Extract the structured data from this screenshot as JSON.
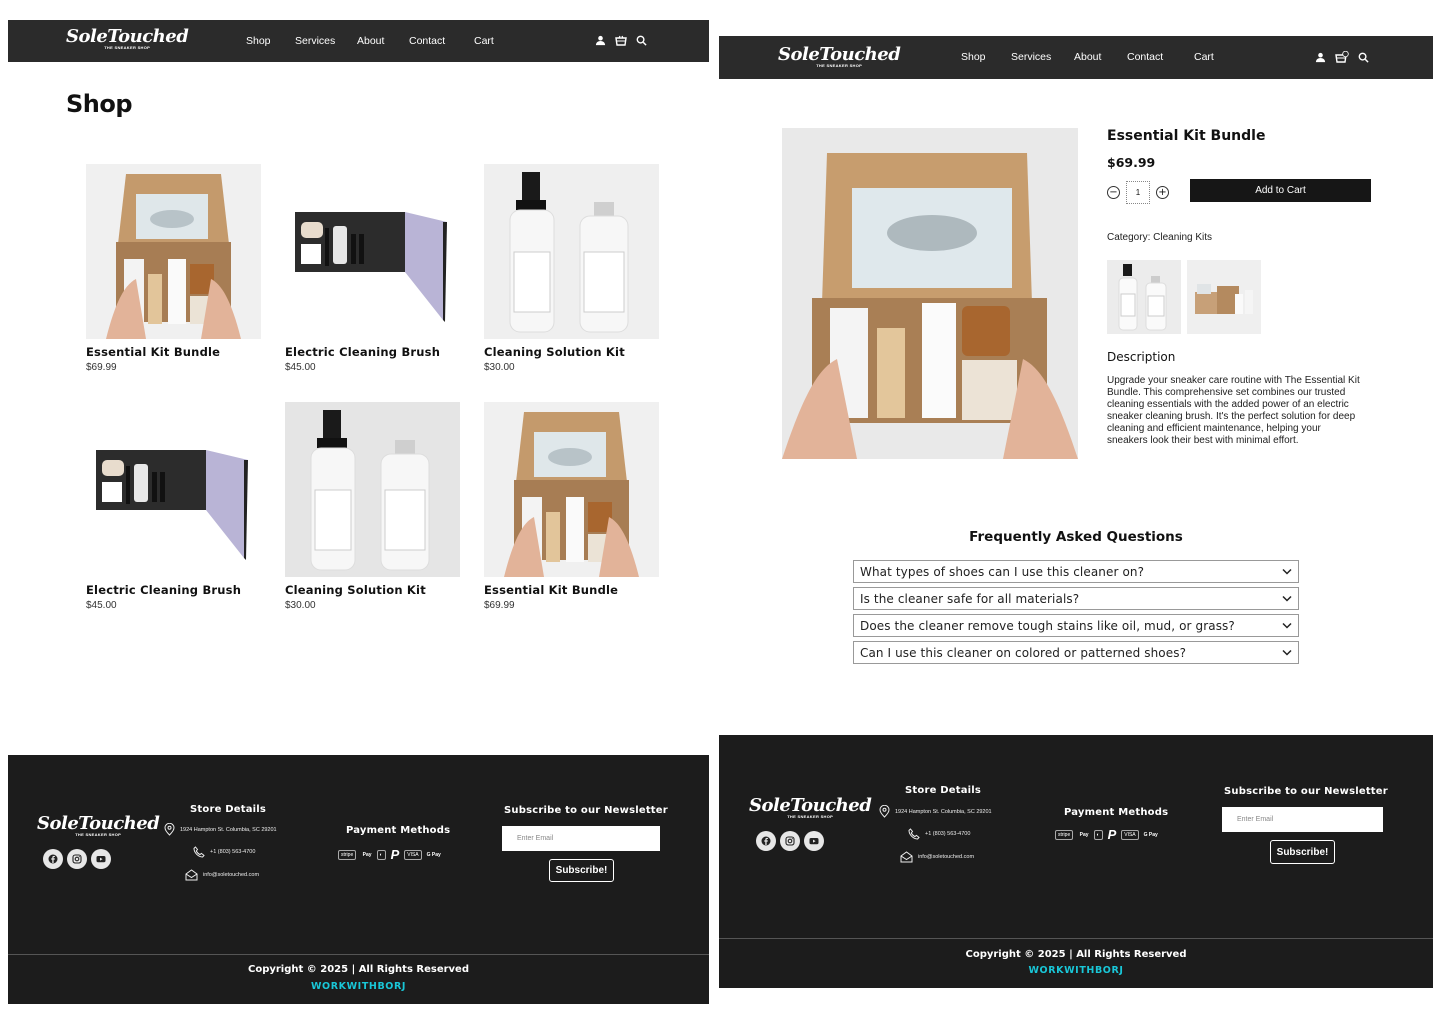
{
  "brand": {
    "name": "SoleTouched",
    "tagline": "THE SNEAKER SHOP"
  },
  "nav": {
    "items": [
      "Shop",
      "Services",
      "About",
      "Contact",
      "Cart"
    ]
  },
  "shop": {
    "title": "Shop",
    "products": [
      {
        "name": "Essential Kit Bundle",
        "price": "$69.99"
      },
      {
        "name": "Electric Cleaning Brush",
        "price": "$45.00"
      },
      {
        "name": "Cleaning Solution Kit",
        "price": "$30.00"
      },
      {
        "name": "Electric Cleaning Brush",
        "price": "$45.00"
      },
      {
        "name": "Cleaning Solution Kit",
        "price": "$30.00"
      },
      {
        "name": "Essential Kit Bundle",
        "price": "$69.99"
      }
    ]
  },
  "product": {
    "title": "Essential Kit Bundle",
    "price": "$69.99",
    "quantity": "1",
    "add_to_cart": "Add to Cart",
    "category": "Category: Cleaning Kits",
    "description_heading": "Description",
    "description": "Upgrade your sneaker care routine with The Essential Kit Bundle. This comprehensive set combines our trusted cleaning essentials with the added power of an electric sneaker cleaning brush. It's the perfect solution for deep cleaning and efficient maintenance, helping your sneakers look their best with minimal effort."
  },
  "faq": {
    "heading": "Frequently Asked Questions",
    "items": [
      "What types of shoes can I use this cleaner on?",
      "Is the cleaner safe for all materials?",
      "Does the cleaner remove tough stains like oil, mud, or grass?",
      "Can I use this cleaner on colored or patterned shoes?"
    ]
  },
  "footer": {
    "store_title": "Store Details",
    "address": "1924 Hampton St. Columbia, SC 29201",
    "phone": "+1 (803) 563-4700",
    "email": "info@soletouched.com",
    "payment_title": "Payment Methods",
    "payments": [
      "stripe",
      " Pay",
      "◐",
      "P",
      "VISA",
      "G Pay"
    ],
    "newsletter_title": "Subscribe to our Newsletter",
    "email_placeholder": "Enter Email",
    "subscribe_label": "Subscribe!",
    "copyright": "Copyright © 2025 | All Rights Reserved",
    "credit": "WORKWITHBORJ"
  },
  "colors": {
    "nav_bg": "#2b2b2b",
    "footer_bg": "#1c1c1c",
    "credit": "#19c7d8",
    "button": "#161616"
  },
  "icons": [
    "user-icon",
    "cart-icon",
    "search-icon",
    "facebook-icon",
    "instagram-icon",
    "youtube-icon",
    "map-pin-icon",
    "phone-icon",
    "mail-icon",
    "chevron-down-icon",
    "minus-icon",
    "plus-icon"
  ]
}
